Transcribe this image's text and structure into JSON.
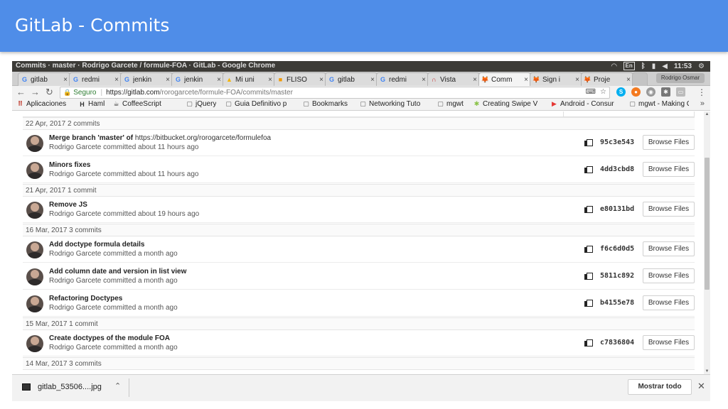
{
  "slide": {
    "title": "GitLab - Commits"
  },
  "window": {
    "title": "Commits · master · Rodrigo Garcete / formule-FOA · GitLab - Google Chrome",
    "tray": {
      "lang": "En",
      "time": "11:53"
    }
  },
  "tabs": [
    {
      "label": "gitlab",
      "icon": "google-icon",
      "glyph": "G",
      "active": false
    },
    {
      "label": "redmi",
      "icon": "google-icon",
      "glyph": "G",
      "active": false
    },
    {
      "label": "jenkin",
      "icon": "google-icon",
      "glyph": "G",
      "active": false
    },
    {
      "label": "jenkin",
      "icon": "google-icon",
      "glyph": "G",
      "active": false
    },
    {
      "label": "Mi uni",
      "icon": "drive-icon",
      "glyph": "▲",
      "active": false
    },
    {
      "label": "FLISO",
      "icon": "fliso-icon",
      "glyph": "■",
      "active": false
    },
    {
      "label": "gitlab",
      "icon": "google-icon",
      "glyph": "G",
      "active": false
    },
    {
      "label": "redmi",
      "icon": "google-icon",
      "glyph": "G",
      "active": false
    },
    {
      "label": "Vista",
      "icon": "vista-icon",
      "glyph": "∩",
      "active": false
    },
    {
      "label": "Comm",
      "icon": "gitlab-fox-icon",
      "glyph": "🦊",
      "active": true
    },
    {
      "label": "Sign i",
      "icon": "gitlab-fox-icon",
      "glyph": "🦊",
      "active": false
    },
    {
      "label": "Proje",
      "icon": "gitlab-fox-icon",
      "glyph": "🦊",
      "active": false
    }
  ],
  "profile": {
    "label": "Rodrigo Osmar"
  },
  "address": {
    "secure_label": "Seguro",
    "url_host": "https://gitlab.com",
    "url_path": "/rorogarcete/formule-FOA/commits/master"
  },
  "bookmarks": [
    {
      "label": "Aplicaciones",
      "icon": "apps-grid-icon",
      "glyph": "⠿"
    },
    {
      "label": "Haml",
      "icon": "haml-icon",
      "glyph": "H"
    },
    {
      "label": "CoffeeScript",
      "icon": "coffee-icon",
      "glyph": "☕"
    },
    {
      "label": "jQuery",
      "icon": "page-icon",
      "glyph": "▢"
    },
    {
      "label": "Guia Definitivo p",
      "icon": "page-icon",
      "glyph": "▢"
    },
    {
      "label": "Bookmarks",
      "icon": "page-icon",
      "glyph": "▢"
    },
    {
      "label": "Networking Tuto",
      "icon": "page-icon",
      "glyph": "▢"
    },
    {
      "label": "mgwt",
      "icon": "page-icon",
      "glyph": "▢"
    },
    {
      "label": "Creating Swipe V",
      "icon": "android-icon",
      "glyph": "✱"
    },
    {
      "label": "Android - Consur",
      "icon": "youtube-icon",
      "glyph": "▶"
    },
    {
      "label": "mgwt - Making C",
      "icon": "page-icon",
      "glyph": "▢"
    }
  ],
  "groups": [
    {
      "date_label": "22 Apr, 2017 2 commits",
      "commits": [
        {
          "title": "Merge branch 'master' of",
          "title_rest": " https://bitbucket.org/rorogarcete/formulefoa",
          "meta": "Rodrigo Garcete committed about 11 hours ago",
          "sha": "95c3e543",
          "browse": "Browse Files"
        },
        {
          "title": "Minors fixes",
          "title_rest": "",
          "meta": "Rodrigo Garcete committed about 11 hours ago",
          "sha": "4dd3cbd8",
          "browse": "Browse Files"
        }
      ]
    },
    {
      "date_label": "21 Apr, 2017 1 commit",
      "commits": [
        {
          "title": "Remove JS",
          "title_rest": "",
          "meta": "Rodrigo Garcete committed about 19 hours ago",
          "sha": "e80131bd",
          "browse": "Browse Files"
        }
      ]
    },
    {
      "date_label": "16 Mar, 2017 3 commits",
      "commits": [
        {
          "title": "Add doctype formula details",
          "title_rest": "",
          "meta": "Rodrigo Garcete committed a month ago",
          "sha": "f6c6d0d5",
          "browse": "Browse Files"
        },
        {
          "title": "Add column date and version in list view",
          "title_rest": "",
          "meta": "Rodrigo Garcete committed a month ago",
          "sha": "5811c892",
          "browse": "Browse Files"
        },
        {
          "title": "Refactoring Doctypes",
          "title_rest": "",
          "meta": "Rodrigo Garcete committed a month ago",
          "sha": "b4155e78",
          "browse": "Browse Files"
        }
      ]
    },
    {
      "date_label": "15 Mar, 2017 1 commit",
      "commits": [
        {
          "title": "Create doctypes of the module FOA",
          "title_rest": "",
          "meta": "Rodrigo Garcete committed a month ago",
          "sha": "c7836804",
          "browse": "Browse Files"
        }
      ]
    },
    {
      "date_label": "14 Mar, 2017 3 commits",
      "commits": []
    }
  ],
  "downloads": {
    "file_name": "gitlab_53506....jpg",
    "show_all": "Mostrar todo"
  }
}
